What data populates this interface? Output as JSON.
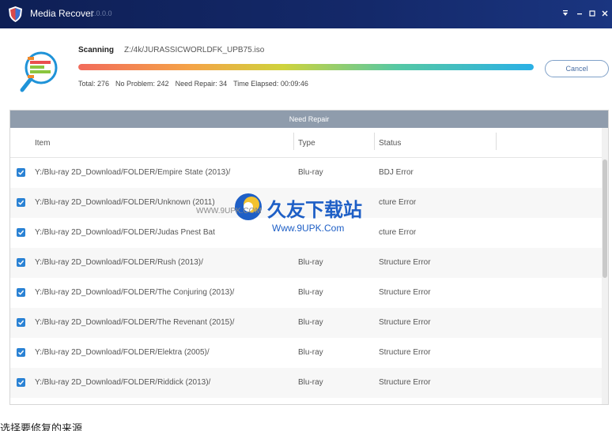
{
  "window": {
    "title": "Media Recover",
    "version": "1.0.0.0",
    "accent": "#14296a"
  },
  "scan": {
    "label": "Scanning",
    "path": "Z:/4k/JURASSICWORLDFK_UPB75.iso",
    "progress": 1.0,
    "stats": {
      "total": "Total: 276",
      "no_problem": "No Problem: 242",
      "need_repair": "Need Repair: 34",
      "time_elapsed": "Time Elapsed: 00:09:46"
    },
    "cancel_label": "Cancel"
  },
  "table": {
    "title": "Need Repair",
    "columns": {
      "item": "Item",
      "type": "Type",
      "status": "Status"
    },
    "rows": [
      {
        "checked": true,
        "item": "Y:/Blu-ray 2D_Download/FOLDER/Empire State (2013)/",
        "type": "Blu-ray",
        "status": "BDJ Error"
      },
      {
        "checked": true,
        "item": "Y:/Blu-ray 2D_Download/FOLDER/Unknown (2011)",
        "type": "",
        "status": "cture Error"
      },
      {
        "checked": true,
        "item": "Y:/Blu-ray 2D_Download/FOLDER/Judas Pnest Bat",
        "type": "",
        "status": "cture Error"
      },
      {
        "checked": true,
        "item": "Y:/Blu-ray 2D_Download/FOLDER/Rush (2013)/",
        "type": "Blu-ray",
        "status": "Structure Error"
      },
      {
        "checked": true,
        "item": "Y:/Blu-ray 2D_Download/FOLDER/The Conjuring (2013)/",
        "type": "Blu-ray",
        "status": "Structure Error"
      },
      {
        "checked": true,
        "item": "Y:/Blu-ray 2D_Download/FOLDER/The Revenant (2015)/",
        "type": "Blu-ray",
        "status": "Structure Error"
      },
      {
        "checked": true,
        "item": "Y:/Blu-ray 2D_Download/FOLDER/Elektra (2005)/",
        "type": "Blu-ray",
        "status": "Structure Error"
      },
      {
        "checked": true,
        "item": "Y:/Blu-ray 2D_Download/FOLDER/Riddick (2013)/",
        "type": "Blu-ray",
        "status": "Structure Error"
      }
    ]
  },
  "watermark": {
    "small": "WWW.9UPK.COM",
    "big": "久友下载站",
    "url": "Www.9UPK.Com"
  },
  "caption": "选择要修复的来源",
  "icons": {
    "app": "shield-icon",
    "scan": "magnifier-scan-icon",
    "menu": "menu-down-icon",
    "minimize": "minimize-icon",
    "maximize": "maximize-icon",
    "close": "close-icon",
    "checkbox": "checkbox-checked-icon"
  }
}
